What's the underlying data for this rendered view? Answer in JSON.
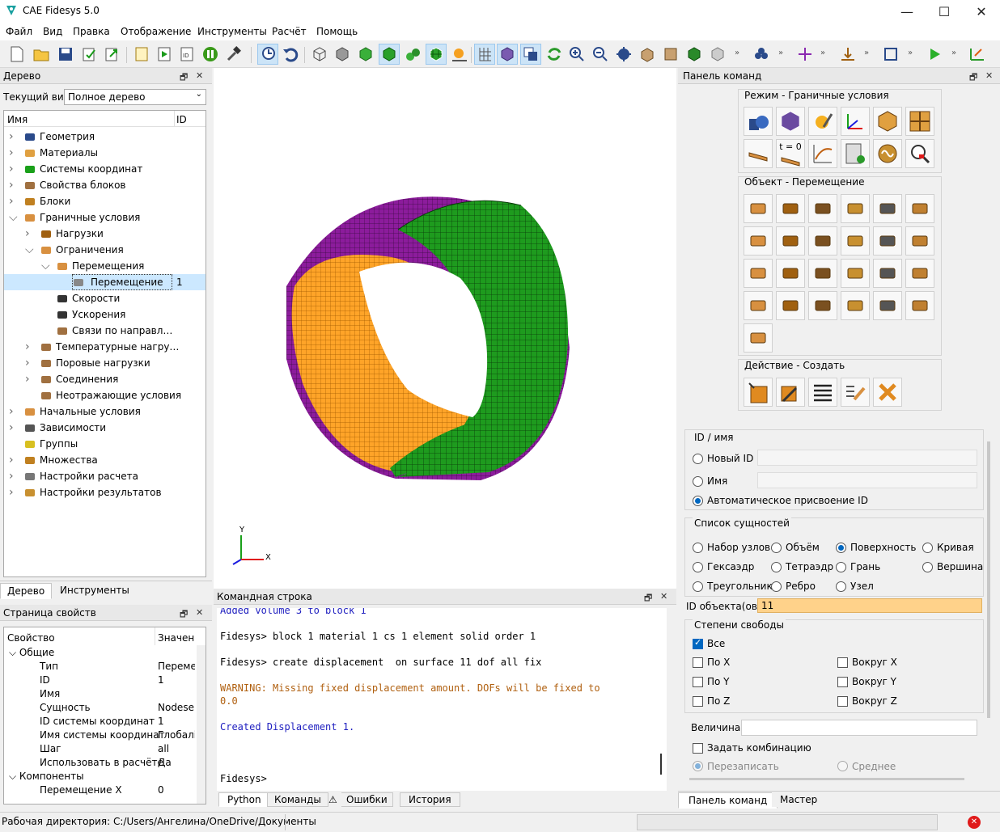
{
  "app": {
    "title": "CAE Fidesys 5.0"
  },
  "window": {
    "minimize": "—",
    "maximize": "☐",
    "close": "✕"
  },
  "menu": [
    "Файл",
    "Вид",
    "Правка",
    "Отображение",
    "Инструменты",
    "Расчёт",
    "Помощь"
  ],
  "tree_panel": {
    "title": "Дерево",
    "view_label": "Текущий вид",
    "view_value": "Полное дерево",
    "col_name": "Имя",
    "col_id": "ID",
    "items": [
      {
        "label": "Геометрия",
        "icon": "geometry-icon"
      },
      {
        "label": "Материалы",
        "icon": "materials-icon"
      },
      {
        "label": "Системы координат",
        "icon": "coord-system-icon"
      },
      {
        "label": "Свойства блоков",
        "icon": "block-properties-icon"
      },
      {
        "label": "Блоки",
        "icon": "blocks-icon"
      },
      {
        "label": "Граничные условия",
        "icon": "boundary-conditions-icon"
      },
      {
        "label": "Нагрузки",
        "icon": "loads-icon"
      },
      {
        "label": "Ограничения",
        "icon": "constraints-icon"
      },
      {
        "label": "Перемещения",
        "icon": "displacements-icon"
      },
      {
        "label": "Перемещение",
        "id": "1",
        "icon": "displacement-icon"
      },
      {
        "label": "Скорости",
        "icon": "velocity-icon"
      },
      {
        "label": "Ускорения",
        "icon": "acceleration-icon"
      },
      {
        "label": "Связи по направл…",
        "icon": "direction-link-icon"
      },
      {
        "label": "Температурные нагру…",
        "icon": "temperature-icon"
      },
      {
        "label": "Поровые нагрузки",
        "icon": "pore-load-icon"
      },
      {
        "label": "Соединения",
        "icon": "connections-icon"
      },
      {
        "label": "Неотражающие условия",
        "icon": "nonreflecting-icon"
      },
      {
        "label": "Начальные условия",
        "icon": "initial-conditions-icon"
      },
      {
        "label": "Зависимости",
        "icon": "dependencies-icon"
      },
      {
        "label": "Группы",
        "icon": "groups-icon"
      },
      {
        "label": "Множества",
        "icon": "sets-icon"
      },
      {
        "label": "Настройки расчета",
        "icon": "calc-settings-icon"
      },
      {
        "label": "Настройки результатов",
        "icon": "results-settings-icon"
      }
    ],
    "tabs": [
      "Дерево",
      "Инструменты"
    ]
  },
  "props_panel": {
    "title": "Страница свойств",
    "col_prop": "Свойство",
    "col_val": "Значен",
    "group": "Общие",
    "rows": [
      {
        "k": "Тип",
        "v": "Переме"
      },
      {
        "k": "ID",
        "v": "1"
      },
      {
        "k": "Имя",
        "v": ""
      },
      {
        "k": "Сущность",
        "v": "Nodese"
      },
      {
        "k": "ID системы координат",
        "v": "1"
      },
      {
        "k": "Имя системы координат",
        "v": "Глобалі"
      },
      {
        "k": "Шаг",
        "v": "all"
      },
      {
        "k": "Использовать в расчёте",
        "v": "Да"
      }
    ],
    "group2": "Компоненты",
    "partial": "Перемещение X",
    "partial_v": "0"
  },
  "viewport": {
    "axis_y": "Y",
    "axis_x": "X"
  },
  "cmdline": {
    "title": "Командная строка",
    "lines": [
      {
        "t": "Added volume 3 to block 1",
        "c": "#2020c0"
      },
      {
        "t": "",
        "c": "#000"
      },
      {
        "t": "Fidesys> block 1 material 1 cs 1 element solid order 1",
        "c": "#000"
      },
      {
        "t": "",
        "c": "#000"
      },
      {
        "t": "Fidesys> create displacement  on surface 11 dof all fix",
        "c": "#000"
      },
      {
        "t": "",
        "c": "#000"
      },
      {
        "t": "WARNING: Missing fixed displacement amount. DOFs will be fixed to",
        "c": "#b06010"
      },
      {
        "t": "0.0",
        "c": "#b06010"
      },
      {
        "t": "",
        "c": "#000"
      },
      {
        "t": "Created Displacement 1.",
        "c": "#2020c0"
      },
      {
        "t": "",
        "c": "#000"
      },
      {
        "t": "",
        "c": "#000"
      },
      {
        "t": "",
        "c": "#000"
      },
      {
        "t": "Fidesys>",
        "c": "#000"
      }
    ],
    "tabs": [
      "Python",
      "Команды",
      "Ошибки",
      "История"
    ]
  },
  "cmdpanel": {
    "title": "Панель команд",
    "mode": "Режим - Граничные условия",
    "object": "Объект - Перемещение",
    "action": "Действие - Создать",
    "id_group": "ID / имя",
    "new_id": "Новый ID",
    "name": "Имя",
    "auto_id": "Автоматическое присвоение ID",
    "entity_group": "Список сущностей",
    "entities": [
      "Набор узлов",
      "Объём",
      "Поверхность",
      "Кривая",
      "Гексаэдр",
      "Тетраэдр",
      "Грань",
      "Вершина",
      "Треугольник",
      "Ребро",
      "Узел"
    ],
    "object_ids_label": "ID объекта(ов)",
    "object_ids_value": "11",
    "dof_group": "Степени свободы",
    "dof": [
      "Все",
      "По X",
      "Вокруг X",
      "По Y",
      "Вокруг Y",
      "По Z",
      "Вокруг Z"
    ],
    "magnitude_label": "Величина",
    "combination_label": "Задать комбинацию",
    "overwrite": "Перезаписать",
    "average": "Среднее",
    "tabs": [
      "Панель команд",
      "Мастер"
    ],
    "t0": "t = 0"
  },
  "statusbar": {
    "workdir": "Рабочая директория: C:/Users/Ангелина/OneDrive/Документы"
  },
  "colors": {
    "accent": "#0067c0",
    "mesh_green": "#1a9a1a",
    "mesh_orange": "#ffa020",
    "mesh_purple": "#8a1a9a",
    "highlight": "#ffd28a"
  }
}
